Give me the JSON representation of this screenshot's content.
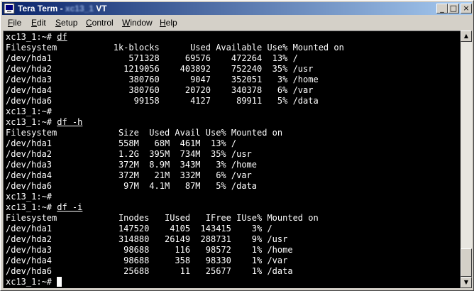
{
  "window": {
    "title": "Tera Term - ",
    "title_hidden_host": "xc13_1",
    "title_suffix": " VT",
    "icon": "teraterm-icon"
  },
  "title_buttons": {
    "minimize": "_",
    "maximize": "□",
    "close": "×"
  },
  "menu": [
    {
      "underline": "F",
      "rest": "ile"
    },
    {
      "underline": "E",
      "rest": "dit"
    },
    {
      "underline": "S",
      "rest": "etup"
    },
    {
      "underline": "C",
      "rest": "ontrol"
    },
    {
      "underline": "W",
      "rest": "indow"
    },
    {
      "underline": "H",
      "rest": "elp"
    }
  ],
  "terminal": {
    "lines": [
      {
        "prompt": "xc13_1:~# ",
        "cmd": "df"
      },
      {
        "text": "Filesystem           1k-blocks      Used Available Use% Mounted on"
      },
      {
        "text": "/dev/hda1               571328     69576    472264  13% /"
      },
      {
        "text": "/dev/hda2              1219056    403892    752240  35% /usr"
      },
      {
        "text": "/dev/hda3               380760      9047    352051   3% /home"
      },
      {
        "text": "/dev/hda4               380760     20720    340378   6% /var"
      },
      {
        "text": "/dev/hda6                99158      4127     89911   5% /data"
      },
      {
        "prompt": "xc13_1:~# ",
        "cmd": ""
      },
      {
        "prompt": "xc13_1:~# ",
        "cmd": "df -h"
      },
      {
        "text": "Filesystem            Size  Used Avail Use% Mounted on"
      },
      {
        "text": "/dev/hda1             558M   68M  461M  13% /"
      },
      {
        "text": "/dev/hda2             1.2G  395M  734M  35% /usr"
      },
      {
        "text": "/dev/hda3             372M  8.9M  343M   3% /home"
      },
      {
        "text": "/dev/hda4             372M   21M  332M   6% /var"
      },
      {
        "text": "/dev/hda6              97M  4.1M   87M   5% /data"
      },
      {
        "prompt": "xc13_1:~# ",
        "cmd": ""
      },
      {
        "prompt": "xc13_1:~# ",
        "cmd": "df -i"
      },
      {
        "text": "Filesystem            Inodes   IUsed   IFree IUse% Mounted on"
      },
      {
        "text": "/dev/hda1             147520    4105  143415    3% /"
      },
      {
        "text": "/dev/hda2             314880   26149  288731    9% /usr"
      },
      {
        "text": "/dev/hda3              98688     116   98572    1% /home"
      },
      {
        "text": "/dev/hda4              98688     358   98330    1% /var"
      },
      {
        "text": "/dev/hda6              25688      11   25677    1% /data"
      },
      {
        "prompt": "xc13_1:~# ",
        "cmd": "",
        "cursor": true
      }
    ]
  },
  "scrollbar": {
    "up": "▲",
    "down": "▼",
    "position": 1.0
  },
  "colors": {
    "title_start": "#0a246a",
    "title_end": "#a6caf0",
    "terminal_bg": "#000000",
    "terminal_fg": "#ffffff",
    "chrome": "#d4d0c8"
  }
}
